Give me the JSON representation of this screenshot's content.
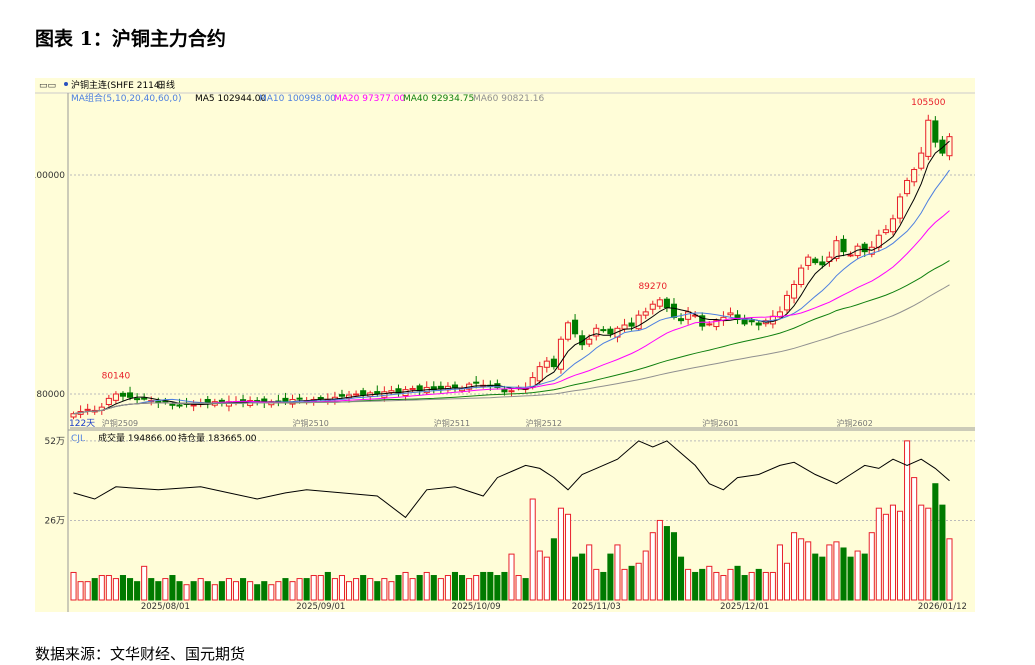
{
  "title": "图表 1：沪铜主力合约",
  "source": "数据来源：文华财经、国元期货",
  "header": {
    "symbol": "沪铜主连(SHFE 2114)",
    "period": "日线"
  },
  "ma_bar": {
    "label": "MA组合(5,10,20,40,60,0)",
    "ma5": "MA5 102944.00",
    "ma10": "MA10 100998.00",
    "ma20": "MA20 97377.00",
    "ma40": "MA40 92934.75",
    "ma60": "MA60 90821.16"
  },
  "vol_bar": {
    "label": "CJL",
    "vol": "成交量 194866.00",
    "oi": "持仓量 183665.00"
  },
  "colors": {
    "up": "#e8202a",
    "down": "#007a00",
    "ma5": "#000000",
    "ma10": "#4d7fe0",
    "ma20": "#ff00ff",
    "ma40": "#108010",
    "ma60": "#909090",
    "bg": "#fffdd8"
  },
  "chart_data": {
    "type": "candlestick",
    "ylim": [
      78000,
      106500
    ],
    "yticks": [
      {
        "v": 80000,
        "t": "80000"
      },
      {
        "v": 100000,
        "t": "100000"
      }
    ],
    "vol_ylim": [
      0,
      52
    ],
    "vol_yticks": [
      {
        "v": 52,
        "t": "52万"
      },
      {
        "v": 26,
        "t": "26万"
      }
    ],
    "annotations": [
      {
        "i": 6,
        "t": "80140"
      },
      {
        "i": 82,
        "t": "89270"
      },
      {
        "i": 121,
        "t": "105500"
      }
    ],
    "bars_label": "122天",
    "contract_labels": [
      {
        "i": 4,
        "t": "沪铜2509"
      },
      {
        "i": 31,
        "t": "沪铜2510"
      },
      {
        "i": 51,
        "t": "沪铜2511"
      },
      {
        "i": 64,
        "t": "沪铜2512"
      },
      {
        "i": 89,
        "t": "沪铜2601"
      },
      {
        "i": 108,
        "t": "沪铜2602"
      }
    ],
    "date_labels": [
      {
        "i": 13,
        "t": "2025/08/01"
      },
      {
        "i": 35,
        "t": "2025/09/01"
      },
      {
        "i": 57,
        "t": "2025/10/09"
      },
      {
        "i": 74,
        "t": "2025/11/03"
      },
      {
        "i": 95,
        "t": "2025/12/01"
      },
      {
        "i": 123,
        "t": "2026/01/12"
      }
    ],
    "close": [
      78200,
      78400,
      78600,
      78500,
      78800,
      79600,
      80000,
      79800,
      79700,
      79500,
      79600,
      79400,
      79200,
      79300,
      79000,
      78900,
      79100,
      79000,
      79200,
      79100,
      79300,
      79200,
      79300,
      79300,
      79200,
      79400,
      79300,
      79200,
      79300,
      79300,
      79200,
      79500,
      79600,
      79400,
      79500,
      79600,
      79500,
      79700,
      79800,
      79900,
      80000,
      79900,
      80100,
      80000,
      80200,
      80300,
      80100,
      80400,
      80500,
      80300,
      80600,
      80400,
      80500,
      80700,
      80600,
      80500,
      80900,
      81000,
      80800,
      80700,
      80600,
      80200,
      80300,
      80600,
      80500,
      81500,
      82500,
      83000,
      82500,
      85000,
      86500,
      85500,
      84500,
      85000,
      86000,
      85800,
      85500,
      86000,
      86300,
      86200,
      87200,
      87500,
      88200,
      88600,
      87900,
      87000,
      86700,
      87500,
      87200,
      86200,
      86400,
      86700,
      87000,
      87400,
      86800,
      86400,
      86600,
      86300,
      86700,
      87100,
      87500,
      89000,
      90000,
      91500,
      92500,
      92000,
      91800,
      92500,
      94000,
      93000,
      92700,
      93500,
      93000,
      93400,
      94500,
      95000,
      96000,
      98000,
      99500,
      100500,
      102000,
      105000,
      103000,
      102000,
      103500
    ],
    "volume": [
      9,
      6,
      6,
      7,
      8,
      8,
      7,
      8,
      7,
      6,
      11,
      7,
      6,
      7,
      8,
      6,
      5,
      6,
      7,
      6,
      5,
      6,
      7,
      6,
      7,
      6,
      5,
      6,
      5,
      6,
      7,
      6,
      7,
      7,
      8,
      8,
      9,
      7,
      8,
      6,
      7,
      8,
      7,
      6,
      7,
      6,
      8,
      9,
      7,
      8,
      9,
      8,
      7,
      8,
      9,
      8,
      7,
      8,
      9,
      9,
      8,
      9,
      15,
      8,
      7,
      33,
      16,
      14,
      20,
      30,
      28,
      14,
      15,
      18,
      10,
      9,
      15,
      18,
      10,
      11,
      12,
      16,
      22,
      26,
      24,
      22,
      14,
      10,
      9,
      10,
      11,
      9,
      8,
      10,
      11,
      8,
      9,
      10,
      9,
      9,
      18,
      12,
      22,
      20,
      19,
      15,
      14,
      18,
      19,
      17,
      14,
      16,
      15,
      22,
      30,
      28,
      31,
      29,
      52,
      40,
      31,
      30,
      38,
      31,
      20
    ],
    "open_interest": [
      [
        0,
        35
      ],
      [
        3,
        33
      ],
      [
        6,
        37
      ],
      [
        12,
        36
      ],
      [
        18,
        37
      ],
      [
        22,
        35
      ],
      [
        26,
        33
      ],
      [
        30,
        35
      ],
      [
        33,
        36
      ],
      [
        38,
        35
      ],
      [
        43,
        34
      ],
      [
        47,
        27
      ],
      [
        50,
        36
      ],
      [
        54,
        37
      ],
      [
        58,
        34
      ],
      [
        60,
        40
      ],
      [
        62,
        42
      ],
      [
        64,
        44
      ],
      [
        66,
        43
      ],
      [
        68,
        40
      ],
      [
        70,
        36
      ],
      [
        72,
        41
      ],
      [
        74,
        43
      ],
      [
        77,
        46
      ],
      [
        80,
        52
      ],
      [
        82,
        50
      ],
      [
        84,
        52
      ],
      [
        86,
        48
      ],
      [
        88,
        44
      ],
      [
        90,
        38
      ],
      [
        92,
        36
      ],
      [
        94,
        40
      ],
      [
        97,
        41
      ],
      [
        100,
        44
      ],
      [
        102,
        45
      ],
      [
        105,
        41
      ],
      [
        108,
        38
      ],
      [
        110,
        41
      ],
      [
        112,
        44
      ],
      [
        114,
        43
      ],
      [
        116,
        46
      ],
      [
        118,
        44
      ],
      [
        120,
        46
      ],
      [
        122,
        43
      ],
      [
        124,
        39
      ]
    ]
  }
}
